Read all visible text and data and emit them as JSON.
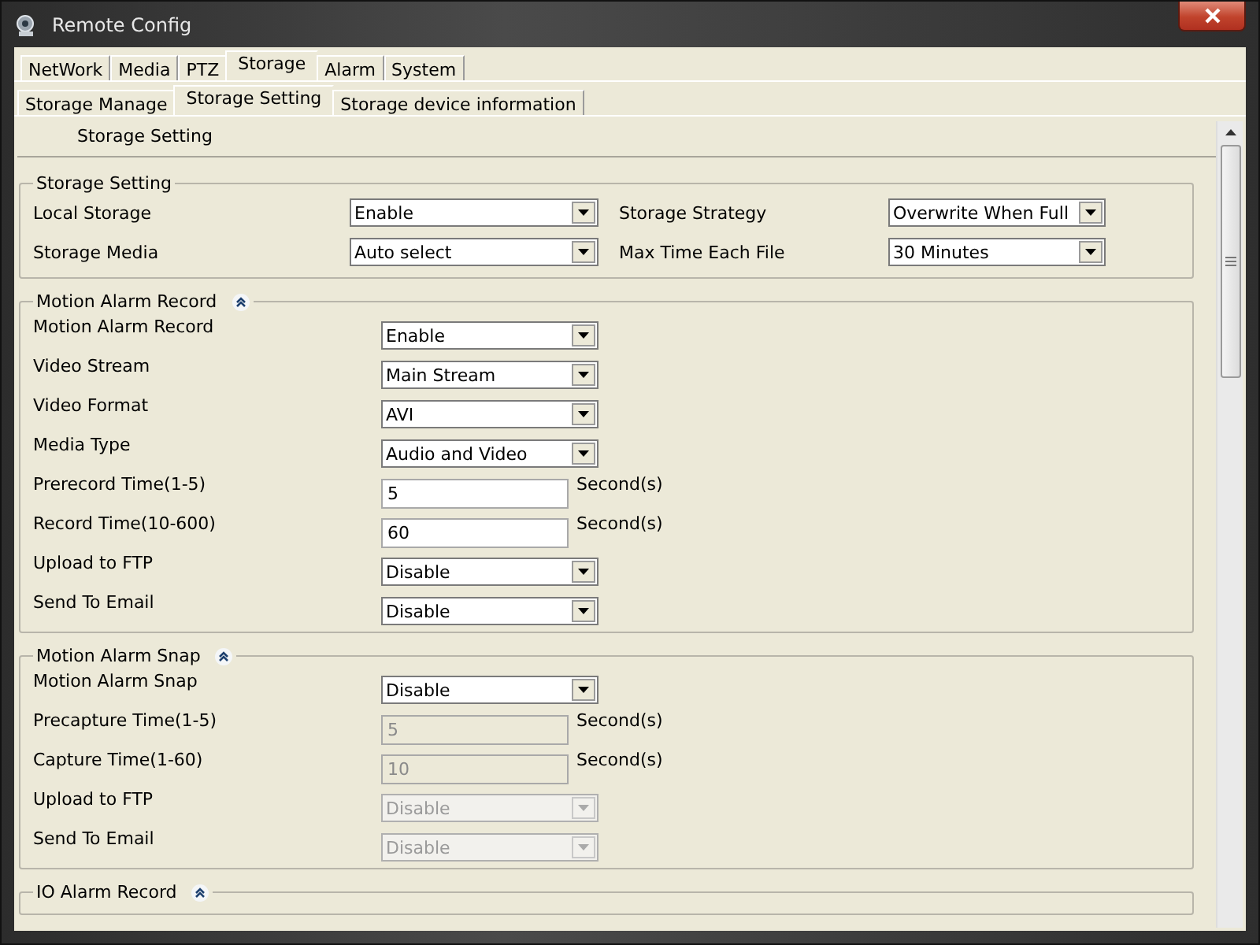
{
  "window": {
    "title": "Remote Config"
  },
  "tabs": [
    {
      "label": "NetWork",
      "selected": false
    },
    {
      "label": "Media",
      "selected": false
    },
    {
      "label": "PTZ",
      "selected": false
    },
    {
      "label": "Storage",
      "selected": true
    },
    {
      "label": "Alarm",
      "selected": false
    },
    {
      "label": "System",
      "selected": false
    }
  ],
  "subtabs": [
    {
      "label": "Storage Manage",
      "selected": false
    },
    {
      "label": "Storage Setting",
      "selected": true
    },
    {
      "label": "Storage device information",
      "selected": false
    }
  ],
  "page_heading": "Storage Setting",
  "storage_setting": {
    "title": "Storage Setting",
    "fields": [
      {
        "label": "Local Storage",
        "value": "Enable",
        "disabled": false
      },
      {
        "label": "Storage Strategy",
        "value": "Overwrite When Full",
        "disabled": false
      },
      {
        "label": "Storage Media",
        "value": "Auto select",
        "disabled": false
      },
      {
        "label": "Max Time Each File",
        "value": "30 Minutes",
        "disabled": false
      }
    ]
  },
  "groups": [
    {
      "title": "Motion Alarm Record",
      "expanded": true,
      "rows": [
        {
          "label": "Motion Alarm Record",
          "kind": "select",
          "value": "Enable",
          "disabled": false
        },
        {
          "label": "Video Stream",
          "kind": "select",
          "value": "Main Stream",
          "disabled": false
        },
        {
          "label": "Video Format",
          "kind": "select",
          "value": "AVI",
          "disabled": false
        },
        {
          "label": "Media Type",
          "kind": "select",
          "value": "Audio and Video",
          "disabled": false
        },
        {
          "label": "Prerecord Time(1-5)",
          "kind": "text",
          "value": "5",
          "unit": "Second(s)",
          "disabled": false
        },
        {
          "label": "Record Time(10-600)",
          "kind": "text",
          "value": "60",
          "unit": "Second(s)",
          "disabled": false
        },
        {
          "label": "Upload to FTP",
          "kind": "select",
          "value": "Disable",
          "disabled": false
        },
        {
          "label": "Send To Email",
          "kind": "select",
          "value": "Disable",
          "disabled": false
        }
      ]
    },
    {
      "title": "Motion Alarm Snap",
      "expanded": true,
      "rows": [
        {
          "label": "Motion Alarm Snap",
          "kind": "select",
          "value": "Disable",
          "disabled": false
        },
        {
          "label": "Precapture Time(1-5)",
          "kind": "text",
          "value": "5",
          "unit": "Second(s)",
          "disabled": true
        },
        {
          "label": "Capture Time(1-60)",
          "kind": "text",
          "value": "10",
          "unit": "Second(s)",
          "disabled": true
        },
        {
          "label": "Upload to FTP",
          "kind": "select",
          "value": "Disable",
          "disabled": true
        },
        {
          "label": "Send To Email",
          "kind": "select",
          "value": "Disable",
          "disabled": true
        }
      ]
    },
    {
      "title": "IO Alarm Record",
      "expanded": true
    }
  ]
}
